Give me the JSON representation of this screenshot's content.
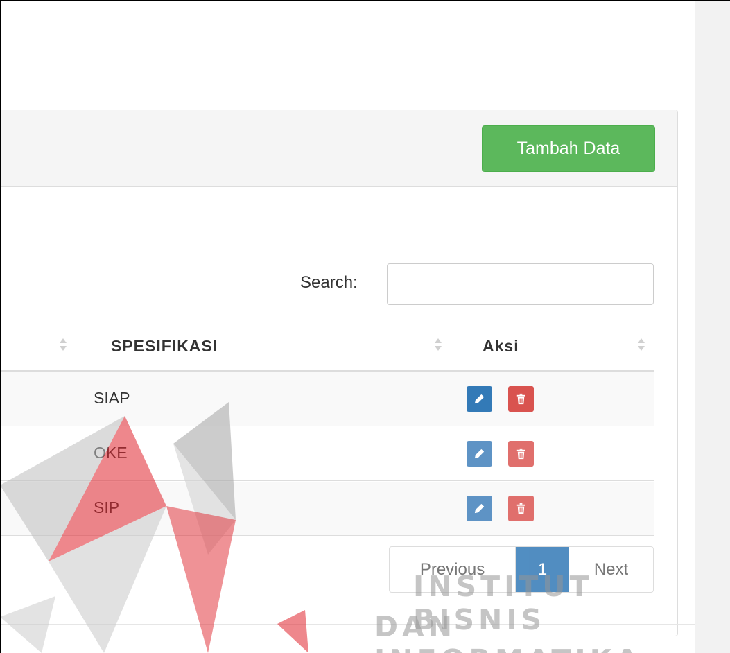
{
  "toolbar": {
    "add_label": "Tambah Data"
  },
  "search": {
    "label": "Search:",
    "value": "",
    "placeholder": ""
  },
  "table": {
    "columns": [
      {
        "label": ""
      },
      {
        "label": "SPESIFIKASI"
      },
      {
        "label": "Aksi"
      }
    ],
    "rows": [
      {
        "spesifikasi": "SIAP"
      },
      {
        "spesifikasi": "OKE"
      },
      {
        "spesifikasi": "SIP"
      }
    ],
    "action_icons": [
      "pencil-icon",
      "trash-icon"
    ]
  },
  "pagination": {
    "previous": "Previous",
    "current": "1",
    "next": "Next"
  },
  "watermark": {
    "line1": "INSTITUT BISNIS",
    "line2": "DAN INFORMATIKA"
  },
  "colors": {
    "primary": "#337ab7",
    "success": "#5cb85c",
    "danger": "#d9534f",
    "watermark_red": "#e0252d"
  }
}
